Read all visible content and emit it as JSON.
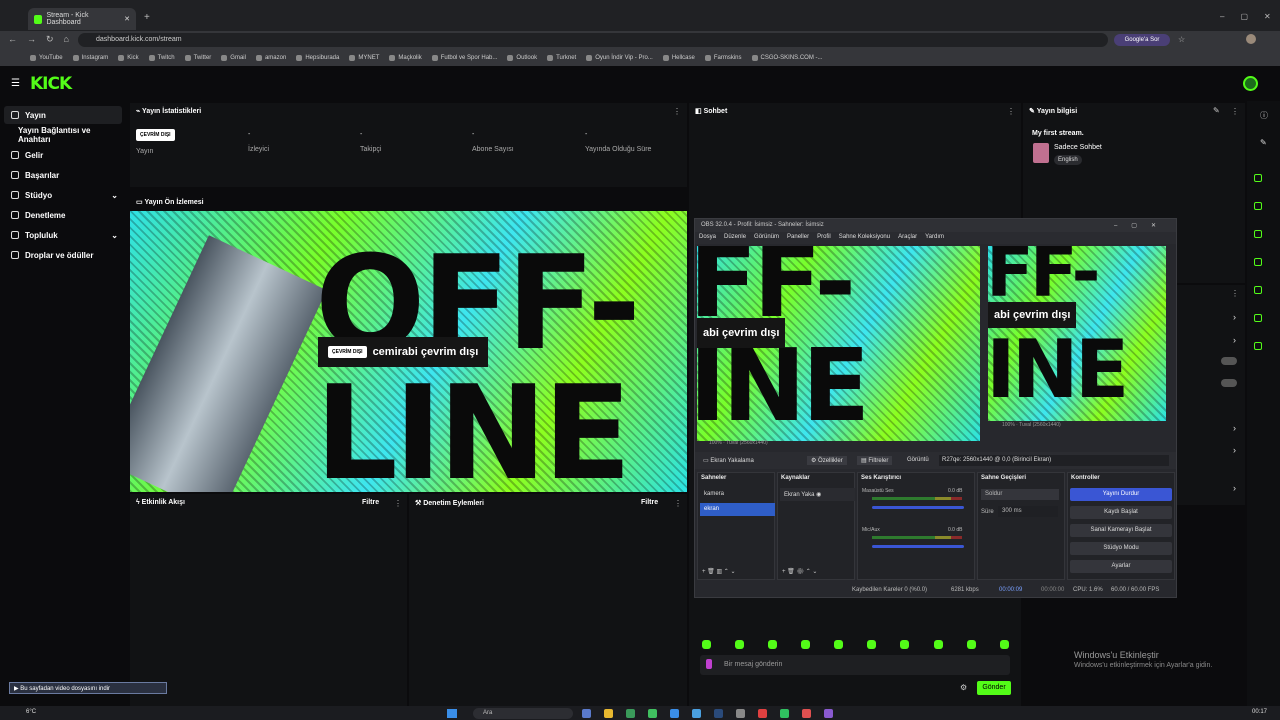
{
  "browser": {
    "tab_title": "Stream - Kick Dashboard",
    "url": "dashboard.kick.com/stream",
    "google_button": "Google'a Sor",
    "bookmarks": [
      "YouTube",
      "Instagram",
      "Kick",
      "Twitch",
      "Twitter",
      "Gmail",
      "amazon",
      "Hepsiburada",
      "MYNET",
      "Maçkolik",
      "Futbol ve Spor Hab...",
      "Outlook",
      "Turknet",
      "Oyun İndir Vip - Pro...",
      "Hellcase",
      "Farmskins",
      "CSGO-SKINS.COM -..."
    ]
  },
  "kick": {
    "logo": "KICK",
    "sidebar": [
      {
        "label": "Yayın",
        "active": true
      },
      {
        "label": "Yayın Bağlantısı ve Anahtarı"
      },
      {
        "label": "Gelir"
      },
      {
        "label": "Başarılar"
      },
      {
        "label": "Stüdyo"
      },
      {
        "label": "Denetleme"
      },
      {
        "label": "Topluluk"
      },
      {
        "label": "Droplar ve ödüller"
      }
    ],
    "stats": {
      "title": "Yayın İstatistikleri",
      "status_badge": "ÇEVRİM DIŞI",
      "items": [
        {
          "value": "",
          "label": "Yayın"
        },
        {
          "value": "-",
          "label": "İzleyici"
        },
        {
          "value": "-",
          "label": "Takipçi"
        },
        {
          "value": "-",
          "label": "Abone Sayısı"
        },
        {
          "value": "-",
          "label": "Yayında Olduğu Süre"
        }
      ]
    },
    "preview": {
      "title": "Yayın Ön İzlemesi",
      "badge": "ÇEVRİM DIŞI",
      "offline_text": "cemirabi çevrim dışı",
      "big_line1": "OFF-",
      "big_line2": "LINE"
    },
    "activity": {
      "title": "Etkinlik Akışı",
      "filter": "Filtre"
    },
    "moderation": {
      "title": "Denetim Eylemleri",
      "filter": "Filtre"
    },
    "chat": {
      "title": "Sohbet",
      "placeholder": "Bir mesaj gönderin",
      "send": "Gönder"
    },
    "stream_info": {
      "title": "Yayın bilgisi",
      "stream_title": "My first stream.",
      "category": "Sadece Sohbet",
      "language": "English"
    }
  },
  "obs": {
    "window_title": "OBS 32.0.4 - Profil: İsimsiz - Sahneler: İsimsiz",
    "menu": [
      "Dosya",
      "Düzenle",
      "Görünüm",
      "Paneller",
      "Profil",
      "Sahne Koleksiyonu",
      "Araçlar",
      "Yardım"
    ],
    "preview_text": "abi çevrim dışı",
    "preview_big1": "FF-",
    "preview_big2": "INE",
    "zoom_left": "100%",
    "canvas_left": "Tuval (2560x1440)",
    "zoom_right": "100%",
    "canvas_right": "Tuval (2560x1440)",
    "source_bar": {
      "source": "Ekran Yakalama",
      "properties": "Özellikler",
      "filters": "Filtreler",
      "display_label": "Görüntü",
      "display_value": "R27qe: 2560x1440 @ 0,0 (Birincil Ekran)"
    },
    "docks": {
      "scenes_title": "Sahneler",
      "scenes": [
        "kamera",
        "ekran"
      ],
      "sources_title": "Kaynaklar",
      "sources": [
        "Ekran Yaka"
      ],
      "mixer_title": "Ses Karıştırıcı",
      "mixer": [
        {
          "name": "Masaüstü Ses",
          "db": "0.0 dB"
        },
        {
          "name": "Mic/Aux",
          "db": "0.0 dB"
        }
      ],
      "transitions_title": "Sahne Geçişleri",
      "transition": "Soldur",
      "duration_label": "Süre",
      "duration": "300 ms",
      "controls_title": "Kontroller",
      "controls": [
        "Yayını Durdur",
        "Kaydı Başlat",
        "Sanal Kamerayı Başlat",
        "Stüdyo Modu",
        "Ayarlar"
      ]
    },
    "status": {
      "dropped": "Kaybedilen Kareler 0 (%0.0)",
      "bitrate": "6281 kbps",
      "stream_time": "00:00:09",
      "rec_time": "00:00:00",
      "cpu": "CPU: 1.6%",
      "fps": "60.00 / 60.00 FPS"
    }
  },
  "windows": {
    "activate_title": "Windows'u Etkinleştir",
    "activate_sub": "Windows'u etkinleştirmek için Ayarlar'a gidin.",
    "download_bar": "Bu sayfadan video dosyasını indir",
    "weather": "6°C",
    "search": "Ara",
    "clock": "00:17"
  },
  "colors": {
    "kick_green": "#53fc18",
    "obs_blue": "#3a56d4",
    "panel": "#111214"
  }
}
